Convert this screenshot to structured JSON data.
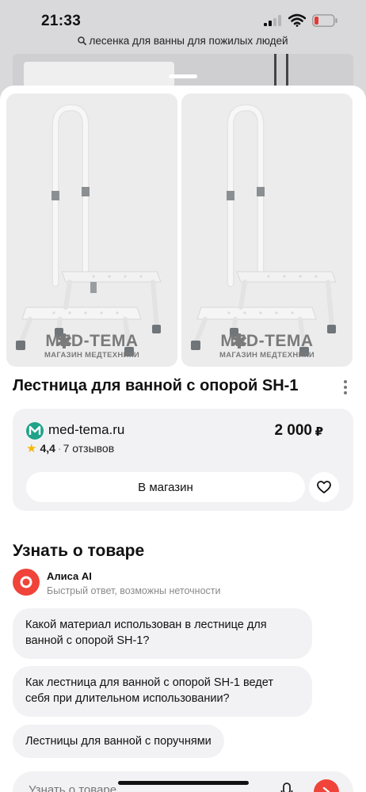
{
  "status_bar": {
    "time": "21:33"
  },
  "search": {
    "query": "лесенка для ванны для пожилых людей"
  },
  "product": {
    "title": "Лестница для ванной с опорой SH-1",
    "watermark_brand": "MED-TEMA",
    "watermark_subtitle": "МАГАЗИН МЕДТЕХНИКИ"
  },
  "offer": {
    "shop_name": "med-tema.ru",
    "price": "2 000",
    "currency": "₽",
    "rating": "4,4",
    "reviews": "7 отзывов",
    "shop_button": "В магазин"
  },
  "about": {
    "heading": "Узнать о товаре",
    "assistant_name": "Алиса AI",
    "assistant_note": "Быстрый ответ, возможны неточности",
    "suggestions": [
      "Какой материал использован в лестнице для ванной с опорой SH-1?",
      "Как лестница для ванной с опорой SH-1 ведет себя при длительном использовании?",
      "Лестницы для ванной с поручнями"
    ],
    "input_placeholder": "Узнать о товаре"
  },
  "colors": {
    "accent": "#f0433a",
    "card_bg": "#f2f2f4",
    "rating_star": "#f6b800",
    "shop_logo": "#1fa38a"
  }
}
